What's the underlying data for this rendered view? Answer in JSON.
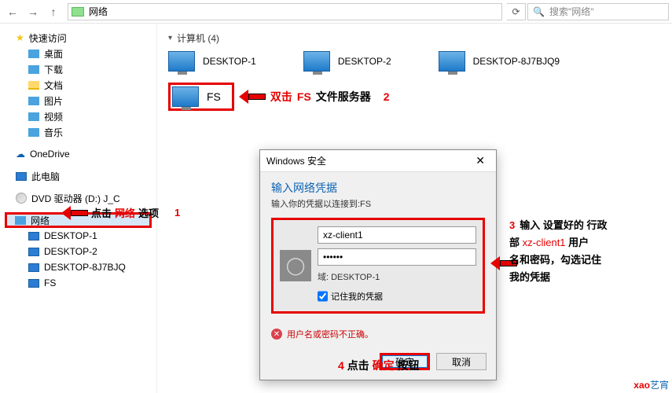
{
  "toolbar": {
    "address": "网络",
    "search_placeholder": "搜索\"网络\""
  },
  "sidebar": {
    "quick": "快速访问",
    "desktop": "桌面",
    "downloads": "下载",
    "documents": "文档",
    "pictures": "图片",
    "videos": "视频",
    "music": "音乐",
    "onedrive": "OneDrive",
    "thispc": "此电脑",
    "dvd": "DVD 驱动器 (D:) J_C",
    "network": "网络",
    "net_children": [
      "DESKTOP-1",
      "DESKTOP-2",
      "DESKTOP-8J7BJQ",
      "FS"
    ]
  },
  "main": {
    "group": "计算机 (4)",
    "items": [
      "DESKTOP-1",
      "DESKTOP-2",
      "DESKTOP-8J7BJQ9",
      "FS"
    ]
  },
  "dialog": {
    "title": "Windows 安全",
    "heading": "输入网络凭据",
    "sub": "输入你的凭据以连接到:FS",
    "username": "xz-client1",
    "password": "••••••",
    "domain": "域: DESKTOP-1",
    "remember": "记住我的凭据",
    "error": "用户名或密码不正确。",
    "ok": "确定",
    "cancel": "取消",
    "close": "✕"
  },
  "annotations": {
    "a1_arrow": "点击",
    "a1_red": "网络",
    "a1_tail": "选项",
    "a1_num": "1",
    "a2_dbl": "双击",
    "a2_fs": "FS",
    "a2_tail": "文件服务器",
    "a2_num": "2",
    "a3_num": "3",
    "a3_l1a": "输入 设置好的 行政",
    "a3_l2a": "部 ",
    "a3_l2b": "xz-client1",
    "a3_l2c": " 用户",
    "a3_l3": "名和密码，勾选记住",
    "a3_l4": "我的凭据",
    "a4_num": "4",
    "a4_a": "点击 ",
    "a4_red": "确定",
    "a4_b": " 按钮"
  },
  "watermark": {
    "x": "xao",
    "rest": "艺宵"
  }
}
